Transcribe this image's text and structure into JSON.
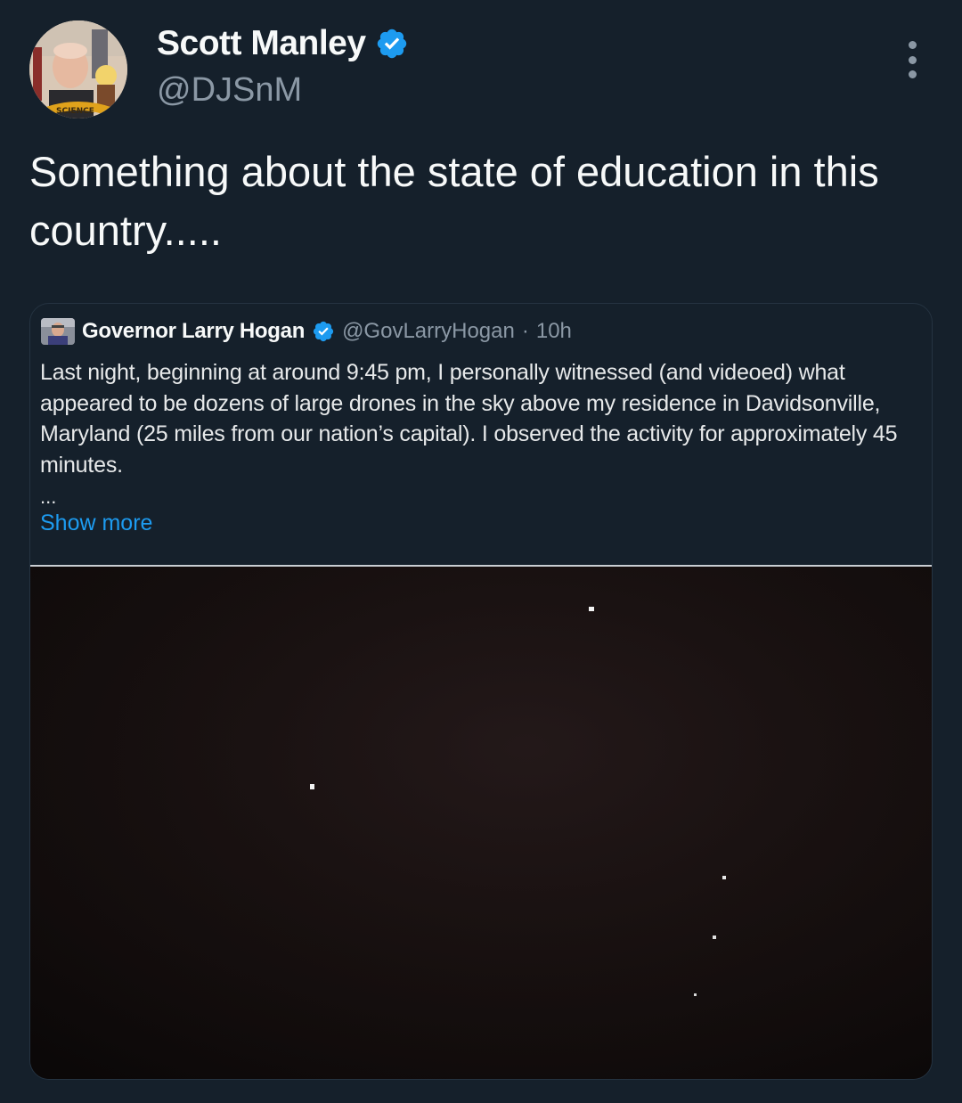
{
  "author": {
    "display_name": "Scott Manley",
    "handle": "@DJSnM",
    "avatar_badge_text": "SCIENCE",
    "verified": true
  },
  "tweet": {
    "text": "Something about the state of education in this country....."
  },
  "quoted_tweet": {
    "display_name": "Governor Larry Hogan",
    "handle": "@GovLarryHogan",
    "separator": "·",
    "time": "10h",
    "verified": true,
    "text": "Last night, beginning at around 9:45 pm, I personally witnessed (and videoed) what appeared to be dozens of large drones in the sky above my residence in Davidsonville, Maryland (25 miles from our nation’s capital). I observed the activity for approximately 45 minutes.",
    "ellipsis": "...",
    "show_more_label": "Show more"
  },
  "icons": {
    "verified": "verified-badge-icon",
    "more": "more-options-icon"
  },
  "colors": {
    "background": "#15202b",
    "accent": "#1d9bf0",
    "secondary_text": "#8b98a5"
  }
}
